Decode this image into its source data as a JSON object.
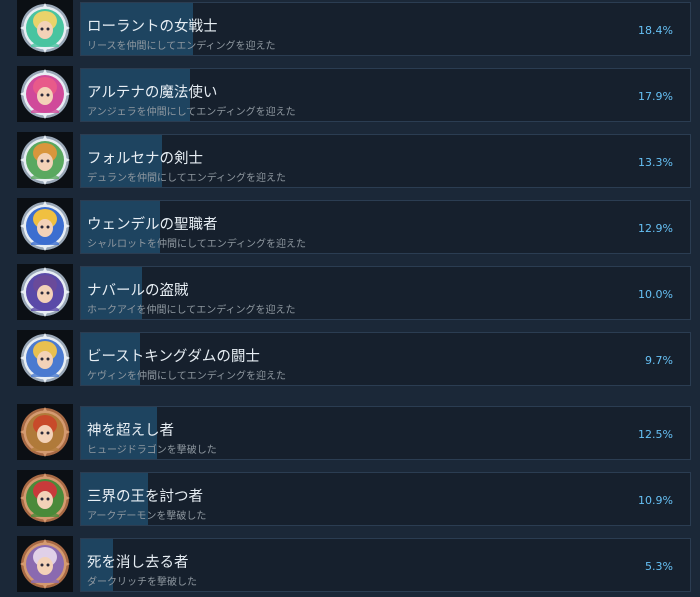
{
  "achievements": [
    {
      "name": "ローラントの女戦士",
      "desc": "リースを仲間にしてエンディングを迎えた",
      "percent": "18.4%",
      "value": 18.4,
      "icon": "character-portrait-icon",
      "frame": "silver",
      "accent": "#49c4a0",
      "hair": "#e9d36a"
    },
    {
      "name": "アルテナの魔法使い",
      "desc": "アンジェラを仲間にしてエンディングを迎えた",
      "percent": "17.9%",
      "value": 17.9,
      "icon": "character-portrait-icon",
      "frame": "silver",
      "accent": "#d04a9a",
      "hair": "#e85a8a"
    },
    {
      "name": "フォルセナの剣士",
      "desc": "デュランを仲間にしてエンディングを迎えた",
      "percent": "13.3%",
      "value": 13.3,
      "icon": "character-portrait-icon",
      "frame": "silver",
      "accent": "#5aa860",
      "hair": "#d9963c"
    },
    {
      "name": "ウェンデルの聖職者",
      "desc": "シャルロットを仲間にしてエンディングを迎えた",
      "percent": "12.9%",
      "value": 12.9,
      "icon": "character-portrait-icon",
      "frame": "silver",
      "accent": "#3c6ed0",
      "hair": "#f0c040"
    },
    {
      "name": "ナバールの盗賊",
      "desc": "ホークアイを仲間にしてエンディングを迎えた",
      "percent": "10.0%",
      "value": 10.0,
      "icon": "character-portrait-icon",
      "frame": "silver",
      "accent": "#5a4aa8",
      "hair": "#6a4a9a"
    },
    {
      "name": "ビーストキングダムの闘士",
      "desc": "ケヴィンを仲間にしてエンディングを迎えた",
      "percent": "9.7%",
      "value": 9.7,
      "icon": "character-portrait-icon",
      "frame": "silver",
      "accent": "#4a7ad0",
      "hair": "#e8c050"
    },
    {
      "name": "神を超えし者",
      "desc": "ヒュージドラゴンを撃破した",
      "percent": "12.5%",
      "value": 12.5,
      "icon": "boss-portrait-icon",
      "frame": "bronze",
      "accent": "#b07a3a",
      "hair": "#c84a2a"
    },
    {
      "name": "三界の王を討つ者",
      "desc": "アークデーモンを撃破した",
      "percent": "10.9%",
      "value": 10.9,
      "icon": "boss-portrait-icon",
      "frame": "bronze",
      "accent": "#4a8a3a",
      "hair": "#c83a3a"
    },
    {
      "name": "死を消し去る者",
      "desc": "ダークリッチを撃破した",
      "percent": "5.3%",
      "value": 5.3,
      "icon": "boss-portrait-icon",
      "frame": "bronze",
      "accent": "#8a6ab0",
      "hair": "#e0d0e8"
    }
  ]
}
